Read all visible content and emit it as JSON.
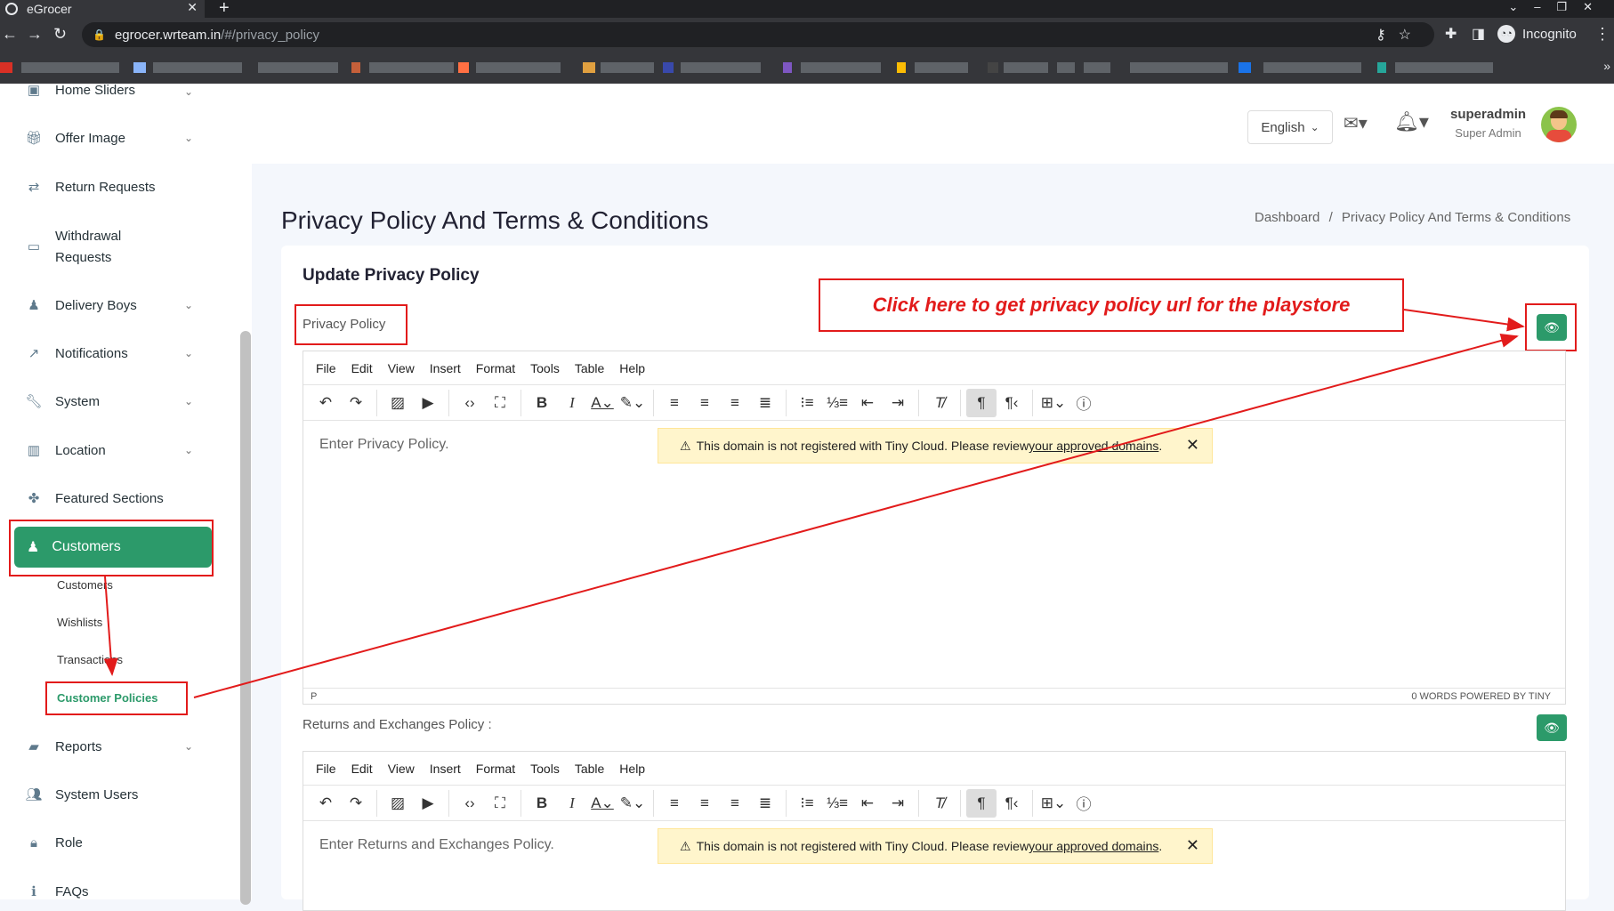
{
  "browser": {
    "tab_title": "eGrocer",
    "url_host": "egrocer.wrteam.in",
    "url_path": "/#/privacy_policy",
    "profile_label": "Incognito"
  },
  "sidebar": {
    "items": [
      {
        "label": "Home Sliders",
        "icon": "image-icon",
        "has_chevron": true
      },
      {
        "label": "Offer Image",
        "icon": "gift-icon",
        "has_chevron": true
      },
      {
        "label": "Return Requests",
        "icon": "return-icon",
        "has_chevron": false
      },
      {
        "label": "Withdrawal",
        "label2": "Requests",
        "icon": "card-icon",
        "has_chevron": false
      },
      {
        "label": "Delivery Boys",
        "icon": "person-icon",
        "has_chevron": true
      },
      {
        "label": "Notifications",
        "icon": "share-icon",
        "has_chevron": true
      },
      {
        "label": "System",
        "icon": "wrench-icon",
        "has_chevron": true
      },
      {
        "label": "Location",
        "icon": "map-icon",
        "has_chevron": true
      },
      {
        "label": "Featured Sections",
        "icon": "puzzle-icon",
        "has_chevron": false
      },
      {
        "label": "Customers",
        "icon": "person-icon",
        "active": true
      },
      {
        "label": "Reports",
        "icon": "folder-icon",
        "has_chevron": true
      },
      {
        "label": "System Users",
        "icon": "users-icon",
        "has_chevron": false
      },
      {
        "label": "Role",
        "icon": "lock-icon",
        "has_chevron": false
      },
      {
        "label": "FAQs",
        "icon": "info-icon",
        "has_chevron": false
      }
    ],
    "customers_sub": [
      "Customers",
      "Wishlists",
      "Transactions",
      "Customer Policies"
    ]
  },
  "header": {
    "language": "English",
    "user_name": "superadmin",
    "user_role": "Super Admin"
  },
  "page": {
    "title": "Privacy Policy And Terms & Conditions",
    "breadcrumb_home": "Dashboard",
    "breadcrumb_sep": "/",
    "breadcrumb_current": "Privacy Policy And Terms & Conditions",
    "card_title": "Update Privacy Policy",
    "callout": "Click here to get privacy policy url for the playstore"
  },
  "editor_menu": [
    "File",
    "Edit",
    "View",
    "Insert",
    "Format",
    "Tools",
    "Table",
    "Help"
  ],
  "editors": [
    {
      "label": "Privacy Policy",
      "placeholder": "Enter Privacy Policy.",
      "notice_text": "This domain is not registered with Tiny Cloud. Please review ",
      "notice_link": "your approved domains",
      "status_left": "P",
      "status_right": "0 WORDS  POWERED BY TINY"
    },
    {
      "label": "Returns and Exchanges Policy :",
      "placeholder": "Enter Returns and Exchanges Policy.",
      "notice_text": "This domain is not registered with Tiny Cloud. Please review ",
      "notice_link": "your approved domains"
    }
  ],
  "colors": {
    "accent": "#2c9a6a",
    "annotation_red": "#e21b1b"
  }
}
